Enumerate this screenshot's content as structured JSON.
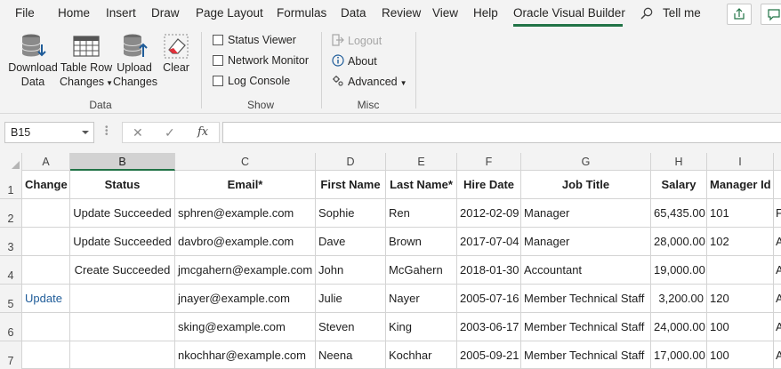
{
  "menu": {
    "tabs": [
      "File",
      "Home",
      "Insert",
      "Draw",
      "Page Layout",
      "Formulas",
      "Data",
      "Review",
      "View",
      "Help",
      "Oracle Visual Builder"
    ],
    "tell_me": "Tell me"
  },
  "ribbon": {
    "data_group": {
      "label": "Data",
      "download": "Download\nData",
      "download_l1": "Download",
      "download_l2": "Data",
      "table_row_l1": "Table Row",
      "table_row_l2": "Changes",
      "upload_l1": "Upload",
      "upload_l2": "Changes",
      "clear": "Clear"
    },
    "show_group": {
      "label": "Show",
      "status_viewer": "Status Viewer",
      "network_monitor": "Network Monitor",
      "log_console": "Log Console"
    },
    "misc_group": {
      "label": "Misc",
      "logout": "Logout",
      "about": "About",
      "advanced": "Advanced"
    }
  },
  "formula_bar": {
    "name_box": "B15",
    "fx": "fx",
    "formula": ""
  },
  "grid": {
    "columns": [
      "A",
      "B",
      "C",
      "D",
      "E",
      "F",
      "G",
      "H",
      "I"
    ],
    "selected_column": "B",
    "rows": [
      "1",
      "2",
      "3",
      "4",
      "5",
      "6",
      "7"
    ],
    "header_row": [
      "Change",
      "Status",
      "Email*",
      "First Name",
      "Last Name*",
      "Hire Date",
      "Job Title",
      "Salary",
      "Manager Id"
    ],
    "data_rows": [
      {
        "change": "",
        "status": "Update Succeeded",
        "email": "sphren@example.com",
        "first": "Sophie",
        "last": "Ren",
        "hire": "2012-02-09",
        "job": "Manager",
        "salary": "65,435.00",
        "manager": "101",
        "overflow": "F"
      },
      {
        "change": "",
        "status": "Update Succeeded",
        "email": "davbro@example.com",
        "first": "Dave",
        "last": "Brown",
        "hire": "2017-07-04",
        "job": "Manager",
        "salary": "28,000.00",
        "manager": "102",
        "overflow": "A"
      },
      {
        "change": "",
        "status": "Create Succeeded",
        "email": "jmcgahern@example.com",
        "first": "John",
        "last": "McGahern",
        "hire": "2018-01-30",
        "job": "Accountant",
        "salary": "19,000.00",
        "manager": "",
        "overflow": "A"
      },
      {
        "change": "Update",
        "status": "",
        "email": "jnayer@example.com",
        "first": "Julie",
        "last": "Nayer",
        "hire": "2005-07-16",
        "job": "Member Technical Staff",
        "salary": "3,200.00",
        "manager": "120",
        "overflow": "A"
      },
      {
        "change": "",
        "status": "",
        "email": "sking@example.com",
        "first": "Steven",
        "last": "King",
        "hire": "2003-06-17",
        "job": "Member Technical Staff",
        "salary": "24,000.00",
        "manager": "100",
        "overflow": "A"
      },
      {
        "change": "",
        "status": "",
        "email": "nkochhar@example.com",
        "first": "Neena",
        "last": "Kochhar",
        "hire": "2005-09-21",
        "job": "Member Technical Staff",
        "salary": "17,000.00",
        "manager": "100",
        "overflow": "A"
      }
    ]
  },
  "colors": {
    "accent_green": "#217346",
    "link_blue": "#1f5c99",
    "ribbon_bg": "#f3f3f3"
  }
}
